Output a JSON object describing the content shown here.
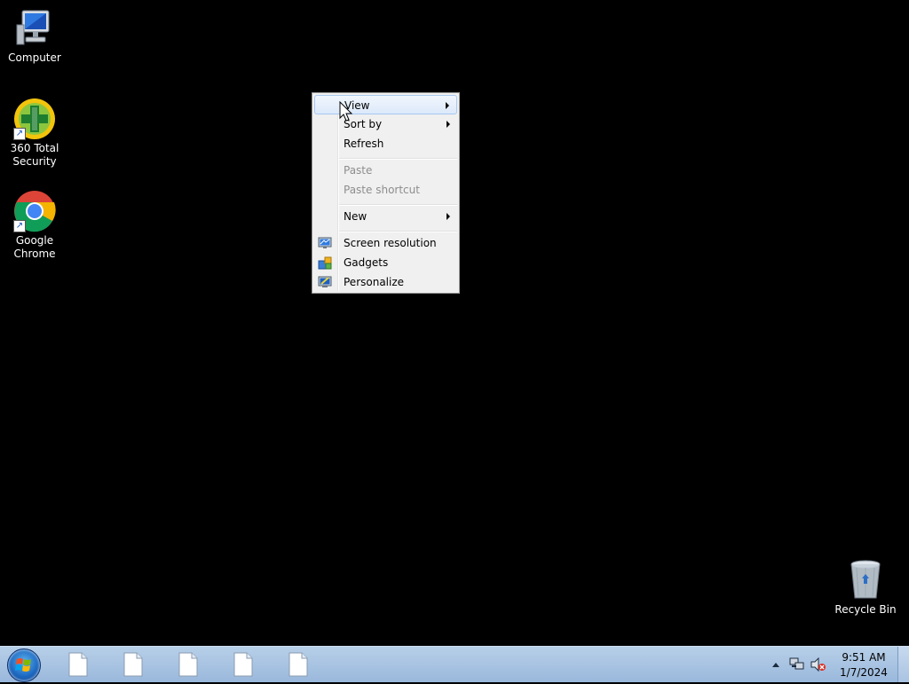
{
  "desktop": {
    "icons": [
      {
        "label": "Computer"
      },
      {
        "label": "360 Total Security"
      },
      {
        "label": "Google Chrome"
      },
      {
        "label": "Recycle Bin"
      }
    ]
  },
  "context_menu": {
    "items": [
      {
        "label": "View",
        "submenu": true,
        "hovered": true
      },
      {
        "label": "Sort by",
        "submenu": true
      },
      {
        "label": "Refresh"
      },
      {
        "label": "Paste",
        "disabled": true
      },
      {
        "label": "Paste shortcut",
        "disabled": true
      },
      {
        "label": "New",
        "submenu": true
      },
      {
        "label": "Screen resolution",
        "icon": "screen-resolution-icon"
      },
      {
        "label": "Gadgets",
        "icon": "gadgets-icon"
      },
      {
        "label": "Personalize",
        "icon": "personalize-icon"
      }
    ]
  },
  "taskbar": {
    "clock_time": "9:51 AM",
    "clock_date": "1/7/2024",
    "task_buttons": [
      "blank-document-icon",
      "blank-document-icon",
      "blank-document-icon",
      "blank-document-icon",
      "blank-document-icon"
    ]
  },
  "colors": {
    "desktop_background": "#000000",
    "menu_background": "#f0f0f0",
    "menu_hover": "#dce9fa",
    "taskbar": "#a9c3e2"
  }
}
